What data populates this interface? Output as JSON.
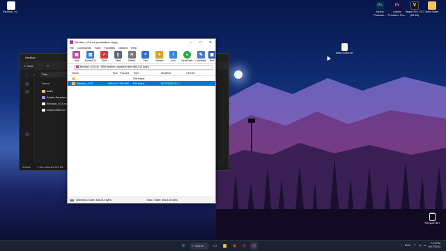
{
  "desktop": {
    "icons_left": [
      {
        "label": "Election_v2...",
        "color": "#ffffff",
        "icon": "document-icon"
      }
    ],
    "icons_right": [
      {
        "label": "Adobe Photosh...",
        "glyph": "Ps",
        "color": "#0b2a4a",
        "fg": "#31a8ff"
      },
      {
        "label": "Adobe Premiere Pro...",
        "glyph": "Pr",
        "color": "#1e0b3a",
        "fg": "#9999ff"
      },
      {
        "label": "Vegas Pro 13.0 (64-bit)",
        "glyph": "V",
        "color": "#1a1a1a",
        "fg": "#ffffff"
      },
      {
        "label": "New folder",
        "glyph": "",
        "color": "#f2c55c",
        "fg": "#f2c55c"
      }
    ],
    "floating_file": {
      "label": "script-roblox.txt"
    },
    "recycle_bin": {
      "label": "Recycle Bin"
    }
  },
  "explorer": {
    "title": "Desktop",
    "new_label": "New",
    "address": "This...",
    "column_name": "Name",
    "files": [
      {
        "name": "main",
        "icon": "folder-icon",
        "color": "#f2c55c"
      },
      {
        "name": "Adobe Premiere Pro...",
        "icon": "app-icon",
        "color": "#9999ff"
      },
      {
        "name": "Election_v2.5.rar",
        "icon": "archive-icon",
        "color": "#ffffff"
      },
      {
        "name": "script-roblox.txt",
        "icon": "text-file-icon",
        "color": "#ffffff"
      }
    ],
    "status_items": "4 items",
    "status_selected": "1 item selected  512 KB"
  },
  "winrar": {
    "title": "Election_v2.5.rar (evaluation copy)",
    "menu": [
      "File",
      "Commands",
      "Tools",
      "Favorites",
      "Options",
      "Help"
    ],
    "tools": [
      {
        "label": "Add",
        "glyph": "▤",
        "color": "#b84a9c"
      },
      {
        "label": "Extract To",
        "glyph": "▥",
        "color": "#3a7bd5"
      },
      {
        "label": "Test",
        "glyph": "✓",
        "color": "#d23c3c"
      },
      {
        "label": "View",
        "glyph": "▯",
        "color": "#5b6b7a"
      },
      {
        "label": "Delete",
        "glyph": "✕",
        "color": "#7a7a7a"
      },
      {
        "label": "Find",
        "glyph": "⌕",
        "color": "#3a6fc4"
      },
      {
        "label": "Wizard",
        "glyph": "✦",
        "color": "#d4a62a"
      },
      {
        "label": "Info",
        "glyph": "i",
        "color": "#3b8ad9"
      },
      {
        "label": "VirusScan",
        "glyph": "●",
        "color": "#2fa84a"
      },
      {
        "label": "Comment",
        "glyph": "✎",
        "color": "#4a7cc7"
      },
      {
        "label": "Prot",
        "glyph": "▣",
        "color": "#3a5ea8"
      }
    ],
    "path_text": "Election_v2.5.rar - RAR archive, unpacked size 665,414 bytes",
    "columns": {
      "name": "Name",
      "size": "Size",
      "packed": "Packed",
      "type": "Type",
      "modified": "Modified",
      "crc": "CRC32"
    },
    "rows": [
      {
        "name": "..",
        "size": "",
        "packed": "",
        "type": "File folder",
        "modified": "",
        "crc": "",
        "selected": false
      },
      {
        "name": "Election_v2.5",
        "size": "665,414",
        "packed": "525,960",
        "type": "File folder",
        "modified": "6/27/2023 12:2...",
        "crc": "",
        "selected": true
      }
    ],
    "status_left": "Selected 1 folder, 665,414 bytes",
    "status_right": "Total 1 folder, 665,414 bytes"
  },
  "taskbar": {
    "search_label": "Search",
    "apps": [
      {
        "name": "start-button",
        "glyph": "⊞",
        "color": "#2f8cff"
      },
      {
        "name": "task-view",
        "glyph": "▭",
        "color": "#cfd6e6"
      },
      {
        "name": "file-explorer",
        "glyph": "▆",
        "color": "#f2c55c"
      },
      {
        "name": "chrome",
        "glyph": "◉",
        "color": "#e4483b"
      },
      {
        "name": "record-app",
        "glyph": "◎",
        "color": "#e04b4b"
      },
      {
        "name": "winrar",
        "glyph": "▤",
        "color": "#b84a9c"
      }
    ],
    "lang": "ENG",
    "time": "7:11 PM",
    "date": "6/27/2023"
  },
  "colors": {
    "selection": "#0078d7",
    "folder": "#f2c55c"
  }
}
